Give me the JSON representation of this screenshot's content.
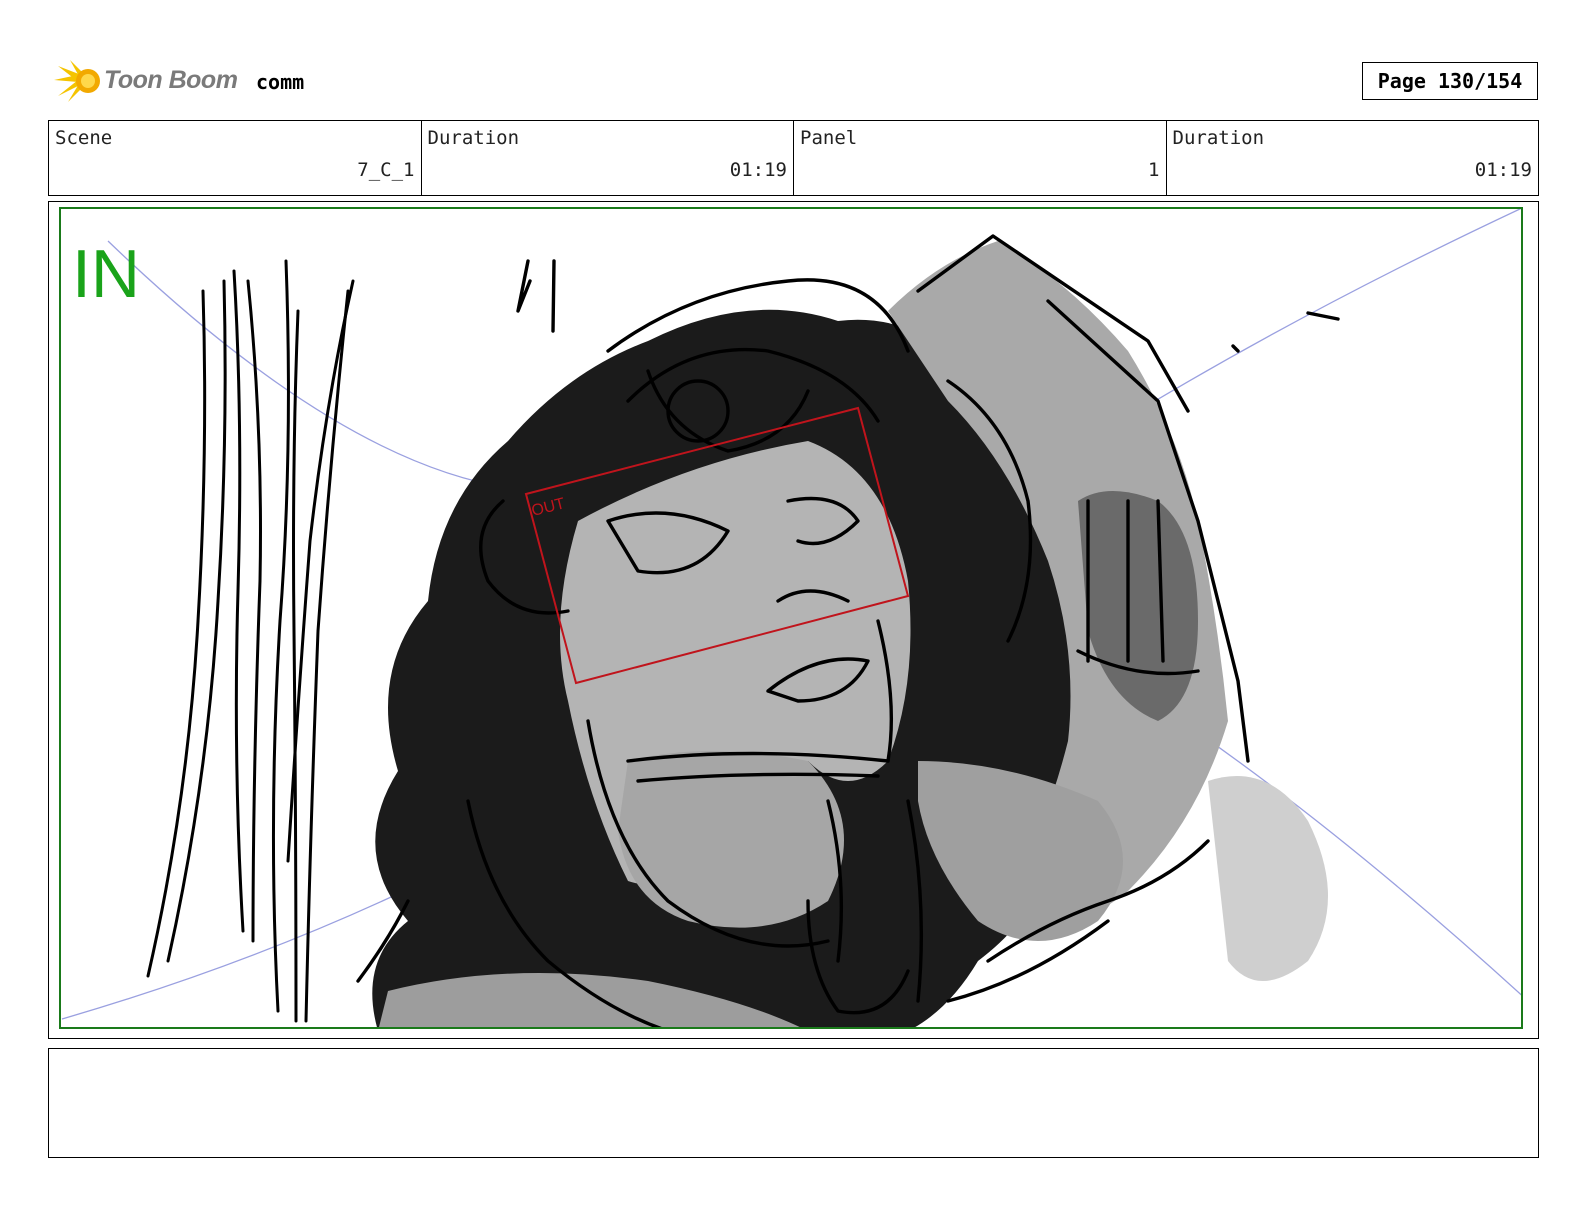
{
  "header": {
    "brand": "Toon Boom",
    "project": "comm",
    "page": "Page 130/154"
  },
  "info": {
    "scene_label": "Scene",
    "scene_value": "7_C_1",
    "scene_duration_label": "Duration",
    "scene_duration_value": "01:19",
    "panel_label": "Panel",
    "panel_value": "1",
    "panel_duration_label": "Duration",
    "panel_duration_value": "01:19"
  },
  "panel": {
    "in_label": "IN",
    "out_label": "OUT",
    "colors": {
      "camera_in": "#1aa31a",
      "camera_out": "#c0141c",
      "guide": "#9aa0e0"
    }
  },
  "notes": {}
}
